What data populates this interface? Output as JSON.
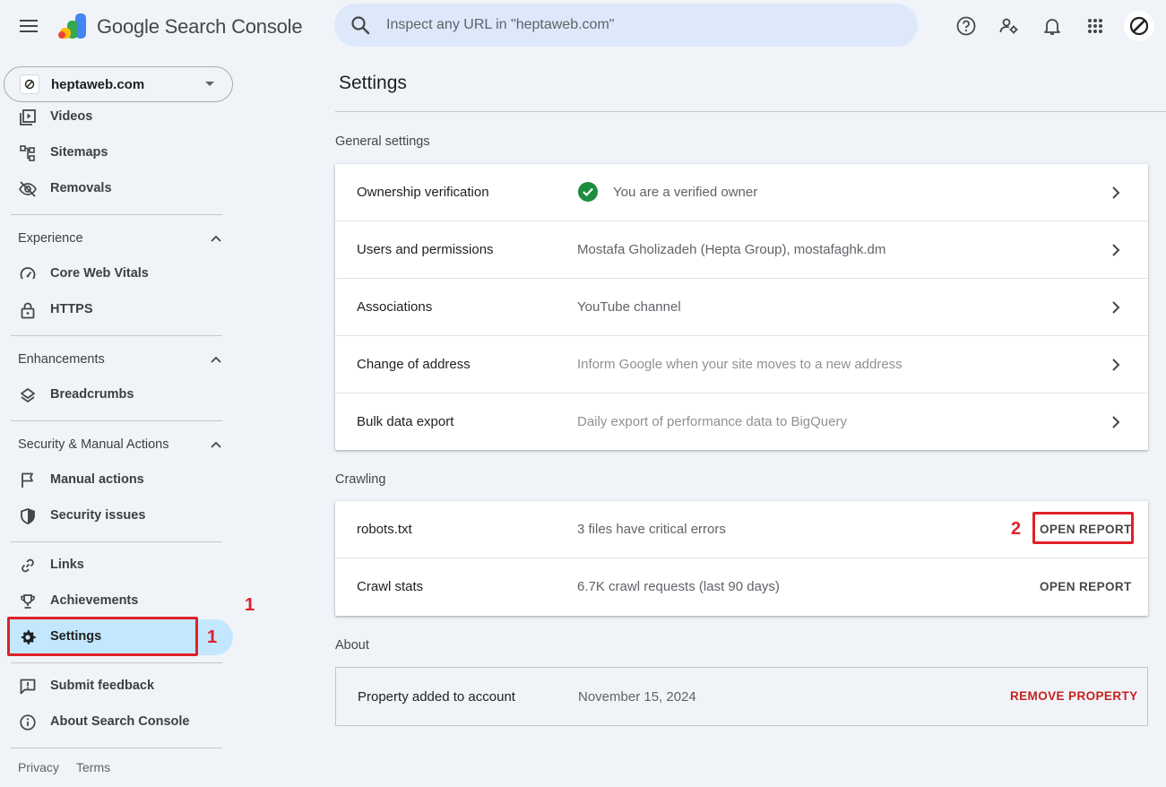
{
  "header": {
    "app_title": "Google Search Console",
    "search_placeholder": "Inspect any URL in \"heptaweb.com\"",
    "icons": [
      "menu-icon",
      "search-icon",
      "help-icon",
      "manage-users-icon",
      "bell-icon",
      "apps-grid-icon",
      "avatar"
    ]
  },
  "property": {
    "name": "heptaweb.com"
  },
  "sidebar": {
    "items_top": [
      {
        "label": "Videos",
        "icon": "video-library-icon"
      },
      {
        "label": "Sitemaps",
        "icon": "sitemap-icon"
      },
      {
        "label": "Removals",
        "icon": "visibility-off-icon"
      }
    ],
    "sections": [
      {
        "title": "Experience",
        "items": [
          {
            "label": "Core Web Vitals",
            "icon": "speed-gauge-icon"
          },
          {
            "label": "HTTPS",
            "icon": "lock-icon"
          }
        ]
      },
      {
        "title": "Enhancements",
        "items": [
          {
            "label": "Breadcrumbs",
            "icon": "layers-icon"
          }
        ]
      },
      {
        "title": "Security & Manual Actions",
        "items": [
          {
            "label": "Manual actions",
            "icon": "flag-icon"
          },
          {
            "label": "Security issues",
            "icon": "shield-icon"
          }
        ]
      }
    ],
    "items_bottom": [
      {
        "label": "Links",
        "icon": "link-icon"
      },
      {
        "label": "Achievements",
        "icon": "trophy-icon"
      },
      {
        "label": "Settings",
        "icon": "gear-icon",
        "active": true
      }
    ],
    "items_footer": [
      {
        "label": "Submit feedback",
        "icon": "feedback-icon"
      },
      {
        "label": "About Search Console",
        "icon": "info-icon"
      }
    ],
    "footer_links": [
      "Privacy",
      "Terms"
    ]
  },
  "main": {
    "title": "Settings",
    "general": {
      "section_label": "General settings",
      "rows": [
        {
          "label": "Ownership verification",
          "value": "You are a verified owner"
        },
        {
          "label": "Users and permissions",
          "value": "Mostafa Gholizadeh (Hepta Group), mostafaghk.dm"
        },
        {
          "label": "Associations",
          "value": "YouTube channel"
        },
        {
          "label": "Change of address",
          "value": "Inform Google when your site moves to a new address"
        },
        {
          "label": "Bulk data export",
          "value": "Daily export of performance data to BigQuery"
        }
      ]
    },
    "crawling": {
      "section_label": "Crawling",
      "rows": [
        {
          "label": "robots.txt",
          "value": "3 files have critical errors",
          "action": "OPEN REPORT"
        },
        {
          "label": "Crawl stats",
          "value": "6.7K crawl requests (last 90 days)",
          "action": "OPEN REPORT"
        }
      ]
    },
    "about": {
      "section_label": "About",
      "label": "Property added to account",
      "value": "November 15, 2024",
      "action": "REMOVE PROPERTY"
    }
  },
  "annotations": {
    "one": "1",
    "two": "2"
  },
  "colors": {
    "accent": "#c2e7ff",
    "annotation": "#e0202a",
    "remove": "#c5221f",
    "verified": "#1e8e3e"
  }
}
